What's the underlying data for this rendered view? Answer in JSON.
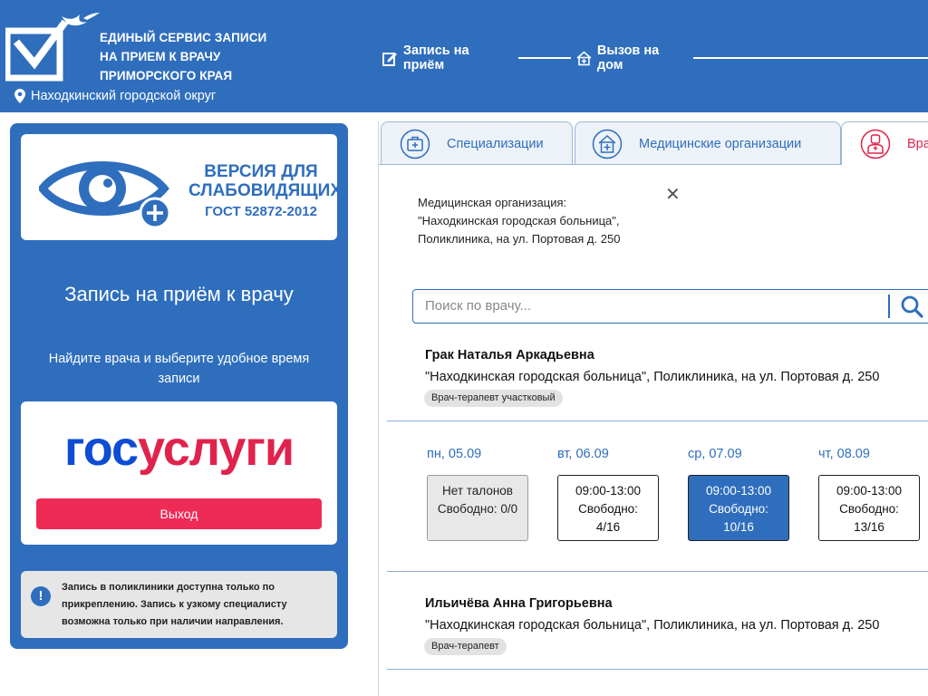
{
  "header": {
    "title_lines": [
      "ЕДИНЫЙ СЕРВИС ЗАПИСИ",
      "НА ПРИЕМ К ВРАЧУ",
      "ПРИМОРСКОГО КРАЯ"
    ],
    "region": "Находкинский городской округ",
    "steps": [
      {
        "label": "Запись на приём",
        "icon": "edit-icon"
      },
      {
        "label": "Вызов на дом",
        "icon": "house-icon"
      }
    ]
  },
  "sidebar": {
    "vision": {
      "line1": "ВЕРСИЯ ДЛЯ",
      "line2": "СЛАБОВИДЯЩИХ",
      "line3": "ГОСТ 52872-2012"
    },
    "heading": "Запись на приём к врачу",
    "subheading": "Найдите врача и выберите удобное время записи",
    "gosuslugi": {
      "part1": "гос",
      "part2": "услуги"
    },
    "logout_label": "Выход",
    "notice": "Запись в поликлиники доступна только по прикреплению. Запись к узкому специалисту возможна только при наличии направления."
  },
  "tabs": [
    {
      "label": "Специализации",
      "icon": "medkit-icon"
    },
    {
      "label": "Медицинские организации",
      "icon": "hospital-icon"
    },
    {
      "label": "Вра",
      "icon": "doctor-icon"
    }
  ],
  "org": {
    "lines": [
      "Медицинская организация:",
      "\"Находкинская городская больница\",",
      "Поликлиника, на ул. Портовая д. 250"
    ]
  },
  "search": {
    "placeholder": "Поиск по врачу..."
  },
  "doctors": [
    {
      "name": "Грак Наталья Аркадьевна",
      "org": "\"Находкинская городская больница\", Поликлиника, на ул. Портовая д. 250",
      "role": "Врач-терапевт участковый",
      "days": [
        {
          "label": "пн, 05.09",
          "line1": "Нет талонов",
          "line2": "Свободно: 0/0",
          "line3": "",
          "state": "none"
        },
        {
          "label": "вт, 06.09",
          "line1": "09:00-13:00",
          "line2": "Свободно:",
          "line3": "4/16",
          "state": "free"
        },
        {
          "label": "ср, 07.09",
          "line1": "09:00-13:00",
          "line2": "Свободно:",
          "line3": "10/16",
          "state": "selected"
        },
        {
          "label": "чт, 08.09",
          "line1": "09:00-13:00",
          "line2": "Свободно:",
          "line3": "13/16",
          "state": "free"
        }
      ]
    },
    {
      "name": "Ильичёва Анна Григорьевна",
      "org": "\"Находкинская городская больница\", Поликлиника, на ул. Портовая д. 250",
      "role": "Врач-терапевт"
    }
  ],
  "colors": {
    "primary": "#2f6ebd",
    "accent_red": "#e0234d",
    "gos_blue": "#0d4cd3"
  }
}
